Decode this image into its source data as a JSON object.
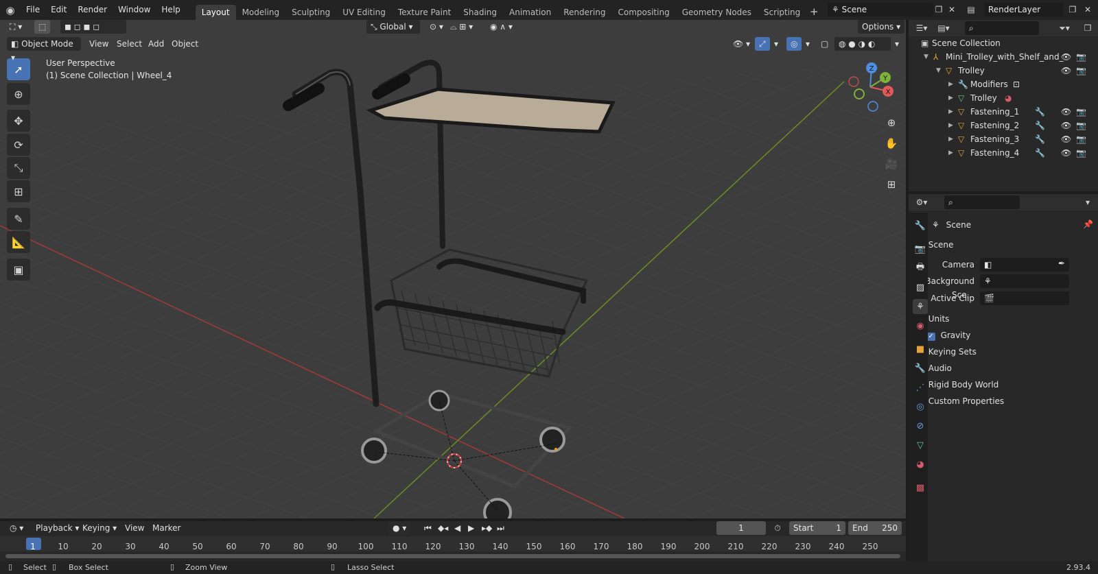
{
  "app": {
    "menu": [
      "File",
      "Edit",
      "Render",
      "Window",
      "Help"
    ],
    "workspaces": [
      "Layout",
      "Modeling",
      "Sculpting",
      "UV Editing",
      "Texture Paint",
      "Shading",
      "Animation",
      "Rendering",
      "Compositing",
      "Geometry Nodes",
      "Scripting"
    ],
    "active_workspace": "Layout",
    "scene_name": "Scene",
    "view_layer": "RenderLayer",
    "version": "2.93.4"
  },
  "viewport": {
    "transform_orientation": "Global",
    "options_label": "Options",
    "mode": "Object Mode",
    "menus": [
      "View",
      "Select",
      "Add",
      "Object"
    ],
    "overlay_title": "User Perspective",
    "overlay_subtitle": "(1) Scene Collection | Wheel_4",
    "gizmo_axes": {
      "z": "Z",
      "y": "Y",
      "x": "X"
    }
  },
  "outliner": {
    "rows": [
      {
        "label": "Scene Collection",
        "icon": "collection-icon"
      },
      {
        "label": "Mini_Trolley_with_Shelf_and_",
        "icon": "empty-icon"
      },
      {
        "label": "Trolley",
        "icon": "mesh-object-icon"
      },
      {
        "label": "Modifiers",
        "icon": "wrench-icon"
      },
      {
        "label": "Trolley",
        "icon": "mesh-data-icon"
      },
      {
        "label": "Fastening_1",
        "icon": "mesh-object-icon"
      },
      {
        "label": "Fastening_2",
        "icon": "mesh-object-icon"
      },
      {
        "label": "Fastening_3",
        "icon": "mesh-object-icon"
      },
      {
        "label": "Fastening_4",
        "icon": "mesh-object-icon"
      }
    ]
  },
  "properties": {
    "context": "Scene",
    "panel": "Scene",
    "fields": [
      {
        "label": "Camera",
        "value": ""
      },
      {
        "label": "Background Sce...",
        "value": ""
      },
      {
        "label": "Active Clip",
        "value": ""
      }
    ],
    "sections": [
      "Units",
      "Gravity",
      "Keying Sets",
      "Audio",
      "Rigid Body World",
      "Custom Properties"
    ],
    "gravity_checked": true
  },
  "timeline": {
    "menus": [
      "Playback",
      "Keying",
      "View",
      "Marker"
    ],
    "current_frame": "1",
    "start_label": "Start",
    "start": "1",
    "end_label": "End",
    "end": "250",
    "ticks": [
      "1",
      "10",
      "20",
      "30",
      "40",
      "50",
      "60",
      "70",
      "80",
      "90",
      "100",
      "110",
      "120",
      "130",
      "140",
      "150",
      "160",
      "170",
      "180",
      "190",
      "200",
      "210",
      "220",
      "230",
      "240",
      "250"
    ]
  },
  "statusbar": {
    "select": "Select",
    "box_select": "Box Select",
    "zoom_view": "Zoom View",
    "lasso_select": "Lasso Select"
  }
}
